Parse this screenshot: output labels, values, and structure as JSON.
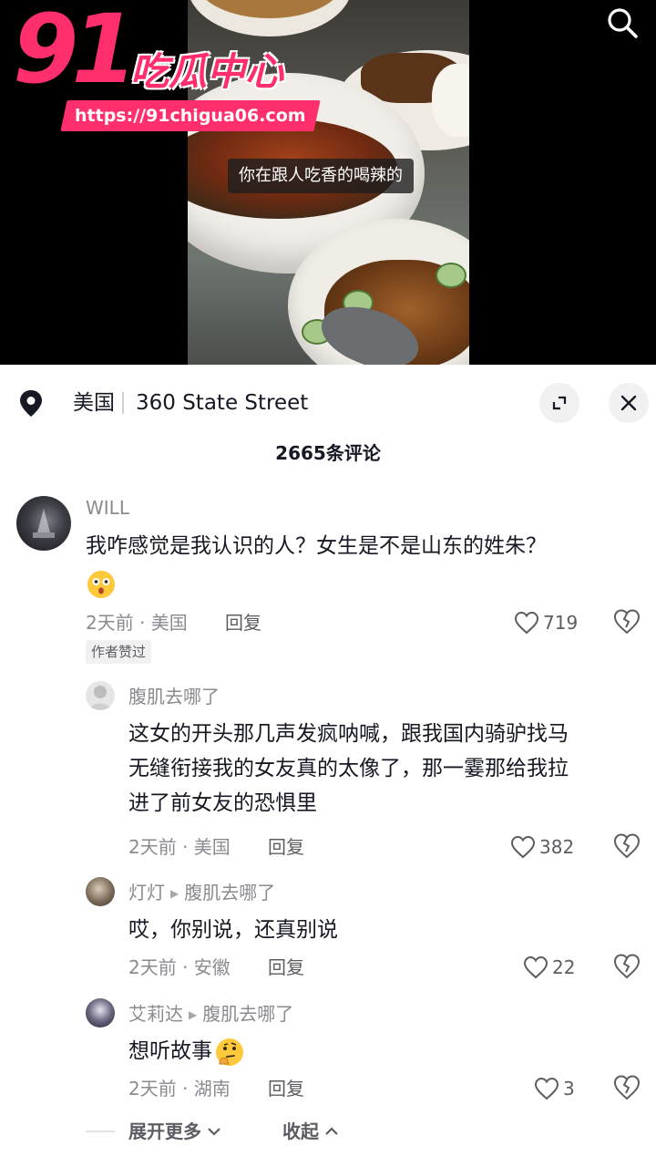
{
  "video": {
    "subtitle": "你在跟人吃香的喝辣的",
    "watermark": {
      "number": "91",
      "name": "吃瓜中心",
      "url": "https://91chigua06.com"
    }
  },
  "location": {
    "country": "美国",
    "street": "360 State Street"
  },
  "comments_count_label": "2665条评论",
  "comments": [
    {
      "username": "WILL",
      "text": "我咋感觉是我认识的人？女生是不是山东的姓朱？",
      "emoji": "surprised-face",
      "time_location": "2天前 · 美国",
      "reply_label": "回复",
      "likes": "719",
      "badge": "作者赞过"
    },
    {
      "username": "腹肌去哪了",
      "text": "这女的开头那几声发疯呐喊，跟我国内骑驴找马无缝衔接我的女友真的太像了，那一霎那给我拉进了前女友的恐惧里",
      "text_lines": [
        "这女的开头那几声发疯呐喊，跟我国内骑驴找马",
        "无缝衔接我的女友真的太像了，那一霎那给我拉",
        "进了前女友的恐惧里"
      ],
      "time_location": "2天前 · 美国",
      "reply_label": "回复",
      "likes": "382"
    },
    {
      "username": "灯灯",
      "reply_to": "腹肌去哪了",
      "text": "哎，你别说，还真别说",
      "time_location": "2天前 · 安徽",
      "reply_label": "回复",
      "likes": "22"
    },
    {
      "username": "艾莉达",
      "reply_to": "腹肌去哪了",
      "text": "想听故事",
      "emoji": "thinking-face",
      "time_location": "2天前 · 湖南",
      "reply_label": "回复",
      "likes": "3"
    }
  ],
  "footer": {
    "expand_more": "展开更多",
    "collapse": "收起"
  },
  "colors": {
    "brand_pink": "#ff2f6e",
    "text_primary": "#161823",
    "text_secondary": "#8a8b91"
  },
  "icons": [
    "search-icon",
    "location-pin-icon",
    "expand-icon",
    "close-icon",
    "heart-icon",
    "broken-heart-icon",
    "chevron-down-icon",
    "chevron-up-icon"
  ]
}
